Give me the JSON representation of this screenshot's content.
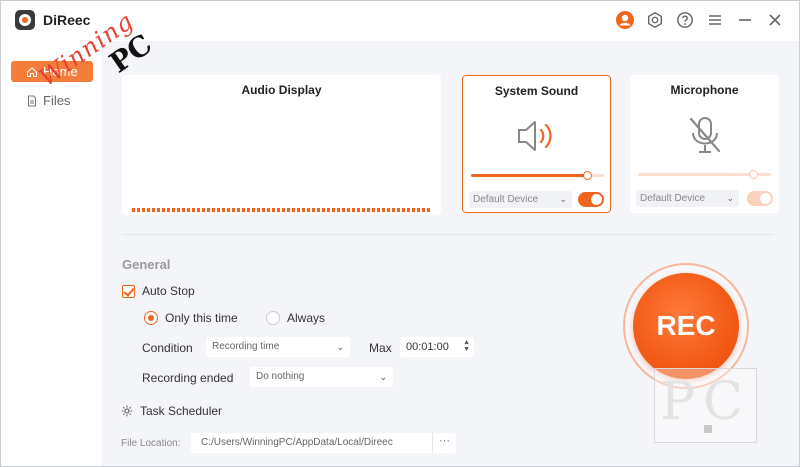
{
  "app": {
    "title": "DiReec"
  },
  "titlebar": {
    "icons": [
      "user-icon",
      "settings-icon",
      "help-icon",
      "menu-icon",
      "minimize-icon",
      "close-icon"
    ],
    "accent": "#f0641e"
  },
  "sidebar": {
    "items": [
      {
        "label": "Home",
        "icon": "home-icon",
        "active": true
      },
      {
        "label": "Files",
        "icon": "file-icon",
        "active": false
      }
    ]
  },
  "audio_display": {
    "title": "Audio Display"
  },
  "system_sound": {
    "title": "System Sound",
    "icon": "speaker-icon",
    "volume_percent": 88,
    "device": "Default Device",
    "enabled": true
  },
  "microphone": {
    "title": "Microphone",
    "icon": "microphone-muted-icon",
    "volume_percent": 87,
    "device": "Default Device",
    "enabled": false
  },
  "general": {
    "title": "General",
    "auto_stop": {
      "label": "Auto Stop",
      "checked": true
    },
    "frequency": {
      "options": [
        "Only this time",
        "Always"
      ],
      "selected": "Only this time"
    },
    "condition": {
      "label": "Condition",
      "value": "Recording time"
    },
    "max": {
      "label": "Max",
      "value": "00:01:00"
    },
    "recording_ended": {
      "label": "Recording ended",
      "value": "Do nothing"
    },
    "task_scheduler": {
      "label": "Task Scheduler",
      "icon": "gear-icon"
    },
    "file_location": {
      "label": "File Location:",
      "value": "C:/Users/WinningPC/AppData/Local/Direec",
      "more": "···"
    }
  },
  "rec_button": {
    "label": "REC",
    "color": "#f25a16"
  },
  "watermark": {
    "script": "Winning",
    "pc": "PC",
    "box": "PC"
  }
}
